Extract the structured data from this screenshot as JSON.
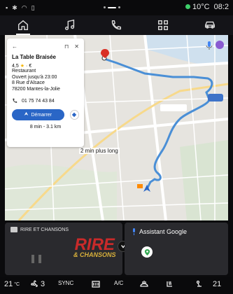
{
  "status_bar": {
    "temperature": "10°C",
    "time": "08:2"
  },
  "nav": {
    "items": [
      {
        "name": "home"
      },
      {
        "name": "music"
      },
      {
        "name": "phone"
      },
      {
        "name": "apps"
      },
      {
        "name": "car"
      }
    ],
    "active": "home"
  },
  "map": {
    "alt_route_label": "2 min plus long",
    "route_color": "#4a8fd6"
  },
  "place_card": {
    "name": "La Table Braisée",
    "rating": "4,5",
    "price": "€",
    "category": "Restaurant",
    "hours": "Ouvert jusqu'à 23:00",
    "street": "8 Rue d'Alsace",
    "city": "78200 Mantes-la-Jolie",
    "phone": "01 75 74 43 84",
    "start_label": "Démarrer",
    "eta": "8 min - 3.1 km"
  },
  "radio_widget": {
    "station": "RIRE ET CHANSONS",
    "logo_line1": "RIRE",
    "logo_line2": "& CHANSONS"
  },
  "assistant_widget": {
    "title": "Assistant Google"
  },
  "climate": {
    "left_temp": "21",
    "left_temp_unit": "°C",
    "fan_level": "3",
    "sync_label": "SYNC",
    "ac_label": "A/C",
    "right_temp": "21"
  }
}
